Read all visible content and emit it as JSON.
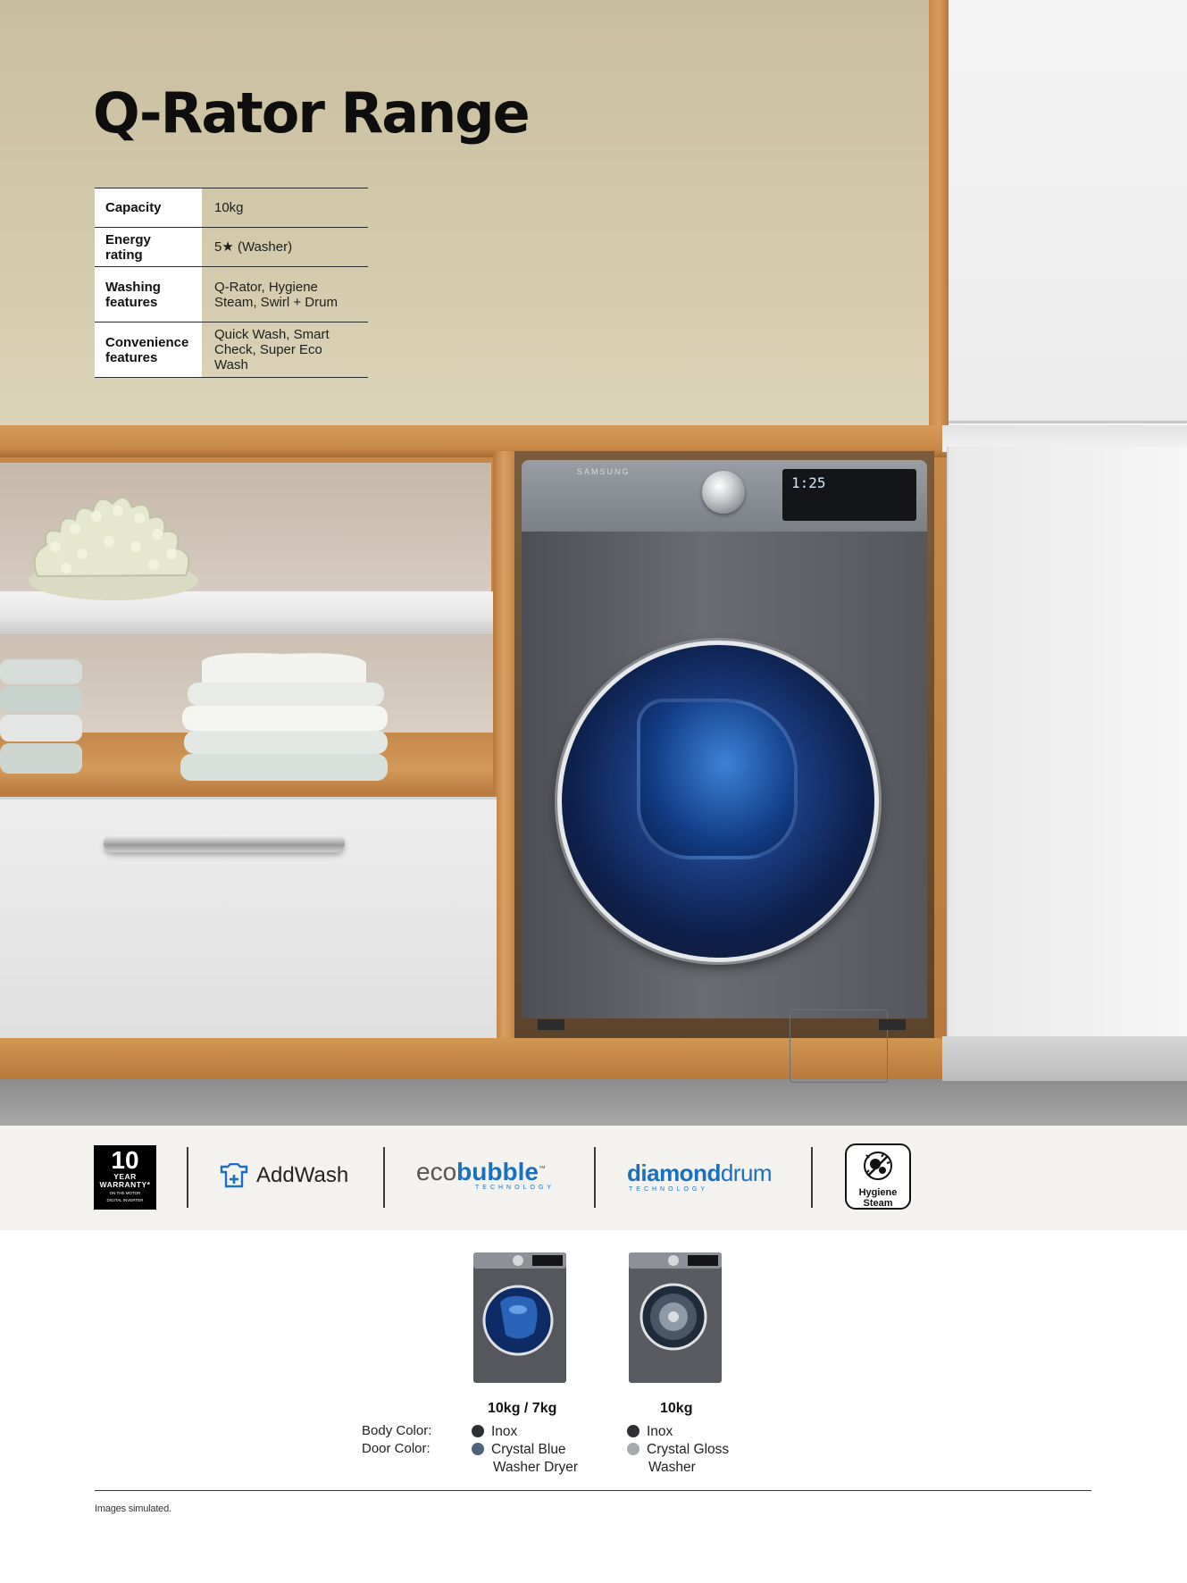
{
  "title": "Q-Rator Range",
  "specs": [
    {
      "label": "Capacity",
      "value": "10kg"
    },
    {
      "label": "Energy rating",
      "value": "5★ (Washer)"
    },
    {
      "label": "Washing features",
      "value": "Q-Rator, Hygiene Steam, Swirl + Drum"
    },
    {
      "label": "Convenience features",
      "value": "Quick Wash, Smart Check, Super Eco Wash"
    }
  ],
  "washer_hero": {
    "brand": "SAMSUNG",
    "display_value": "1:25"
  },
  "features": {
    "warranty": {
      "number": "10",
      "line1": "YEAR",
      "line2": "WARRANTY*",
      "line3": "ON THE MOTOR",
      "line4": "DIGITAL INVERTER"
    },
    "addwash": {
      "label": "AddWash"
    },
    "ecobubble": {
      "prefix": "eco",
      "brand": "bubble",
      "tm": "™",
      "sub": "TECHNOLOGY"
    },
    "diamonddrum": {
      "prefix": "diamond",
      "brand": "drum",
      "sub": "TECHNOLOGY"
    },
    "hygiene": {
      "label_line1": "Hygiene",
      "label_line2": "Steam"
    }
  },
  "products": [
    {
      "capacity": "10kg / 7kg",
      "body_color": "Inox",
      "door_color": "Crystal Blue",
      "type": "Washer Dryer",
      "body_dot": "#2e2f33",
      "door_dot": "#4f6379"
    },
    {
      "capacity": "10kg",
      "body_color": "Inox",
      "door_color": "Crystal Gloss",
      "type": "Washer",
      "body_dot": "#2e2f33",
      "door_dot": "#a7a9ad"
    }
  ],
  "row_labels": {
    "body": "Body Color:",
    "door": "Door Color:"
  },
  "footnote": "Images simulated.",
  "colors": {
    "accent_blue": "#1b6fbf",
    "wood": "#c98a49",
    "washer_inox": "#5a5c61"
  }
}
